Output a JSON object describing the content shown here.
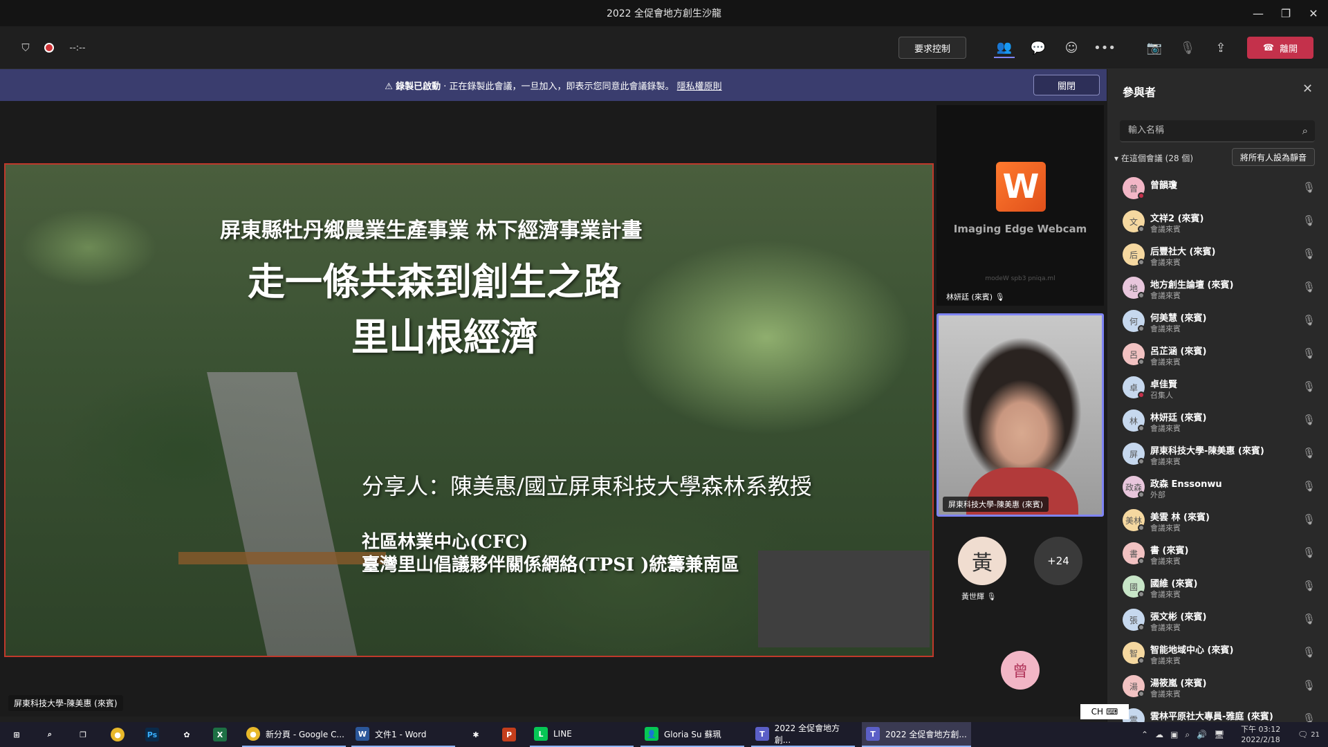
{
  "window": {
    "title": "2022 全促會地方創生沙龍"
  },
  "toolbar": {
    "timer": "--:--",
    "request_control": "要求控制",
    "leave": "離開"
  },
  "banner": {
    "status": "錄製已啟動",
    "message": "正在錄製此會議，一旦加入，即表示您同意此會議錄製。",
    "link": "隱私權原則",
    "close": "關閉"
  },
  "slide": {
    "line1": "屏東縣牡丹鄉農業生產事業  林下經濟事業計畫",
    "line2": "走一條共森到創生之路",
    "line3": "里山根經濟",
    "line4": "分享人：陳美惠/國立屏東科技大學森林系教授",
    "line5": "社區林業中心(CFC)",
    "line6": "臺灣里山倡議夥伴關係網絡(TPSI )統籌兼南區"
  },
  "presenter_tag": "屏東科技大學-陳美惠 (來賓)",
  "tiles": {
    "webcam_name": "Imaging Edge Webcam",
    "webcam_sub": "modeW spb3 pniqa.ml",
    "webcam_user": "林妍廷 (來賓)",
    "speaker_name": "屏東科技大學-陳美惠 (來賓)",
    "avatar1_initial": "黃",
    "avatar1_name": "黃世輝",
    "more_count": "+24",
    "avatar2_initial": "曾"
  },
  "panel": {
    "title": "參與者",
    "search_placeholder": "輸入名稱",
    "section": "在這個會議 (28 個)",
    "mute_all": "將所有人設為靜音",
    "participants": [
      {
        "initial": "曾",
        "name": "曾韻瓊",
        "role": "",
        "color": "#f2b6c6",
        "status": "#c4314b"
      },
      {
        "initial": "文",
        "name": "文祥2 (來賓)",
        "role": "會議來賓",
        "color": "#f5d8a0",
        "status": "#8a8a8a"
      },
      {
        "initial": "后",
        "name": "后豐社大 (來賓)",
        "role": "會議來賓",
        "color": "#f5d8a0",
        "status": "#8a8a8a"
      },
      {
        "initial": "地",
        "name": "地方創生論壇 (來賓)",
        "role": "會議來賓",
        "color": "#e8c6dc",
        "status": "#8a8a8a"
      },
      {
        "initial": "何",
        "name": "何美慧 (來賓)",
        "role": "會議來賓",
        "color": "#c6d8ee",
        "status": "#8a8a8a"
      },
      {
        "initial": "呂",
        "name": "呂芷涵 (來賓)",
        "role": "會議來賓",
        "color": "#f2c2c2",
        "status": "#8a8a8a"
      },
      {
        "initial": "卓",
        "name": "卓佳賢",
        "role": "召集人",
        "color": "#c6d8ee",
        "status": "#c4314b"
      },
      {
        "initial": "林",
        "name": "林妍廷 (來賓)",
        "role": "會議來賓",
        "color": "#c6d8ee",
        "status": "#8a8a8a"
      },
      {
        "initial": "屏",
        "name": "屏東科技大學-陳美惠 (來賓)",
        "role": "會議來賓",
        "color": "#c6d8ee",
        "status": "#8a8a8a"
      },
      {
        "initial": "政森",
        "name": "政森 Enssonwu",
        "role": "外部",
        "color": "#e8c6dc",
        "status": "#8a8a8a"
      },
      {
        "initial": "美林",
        "name": "美雲 林 (來賓)",
        "role": "會議來賓",
        "color": "#f5d8a0",
        "status": "#8a8a8a"
      },
      {
        "initial": "書",
        "name": "書 (來賓)",
        "role": "會議來賓",
        "color": "#f2c2c2",
        "status": "#8a8a8a"
      },
      {
        "initial": "國",
        "name": "國維 (來賓)",
        "role": "會議來賓",
        "color": "#c8e6c8",
        "status": "#8a8a8a"
      },
      {
        "initial": "張",
        "name": "張文彬 (來賓)",
        "role": "會議來賓",
        "color": "#c6d8ee",
        "status": "#8a8a8a"
      },
      {
        "initial": "智",
        "name": "智能地域中心 (來賓)",
        "role": "會議來賓",
        "color": "#f5d8a0",
        "status": "#8a8a8a"
      },
      {
        "initial": "湯",
        "name": "湯筱嵐 (來賓)",
        "role": "會議來賓",
        "color": "#f2c2c2",
        "status": "#8a8a8a"
      },
      {
        "initial": "雲",
        "name": "雲林平原社大專員-雅庭 (來賓)",
        "role": "",
        "color": "#c6d8ee",
        "status": "#8a8a8a"
      }
    ]
  },
  "taskbar": {
    "chrome": "新分頁 - Google C...",
    "word": "文件1 - Word",
    "line": "LINE",
    "gloria": "Gloria Su 蘇珮",
    "teams1": "2022 全促會地方創...",
    "teams2": "2022 全促會地方創...",
    "ime": "CH",
    "time": "下午 03:12",
    "date": "2022/2/18",
    "notif": "21"
  }
}
